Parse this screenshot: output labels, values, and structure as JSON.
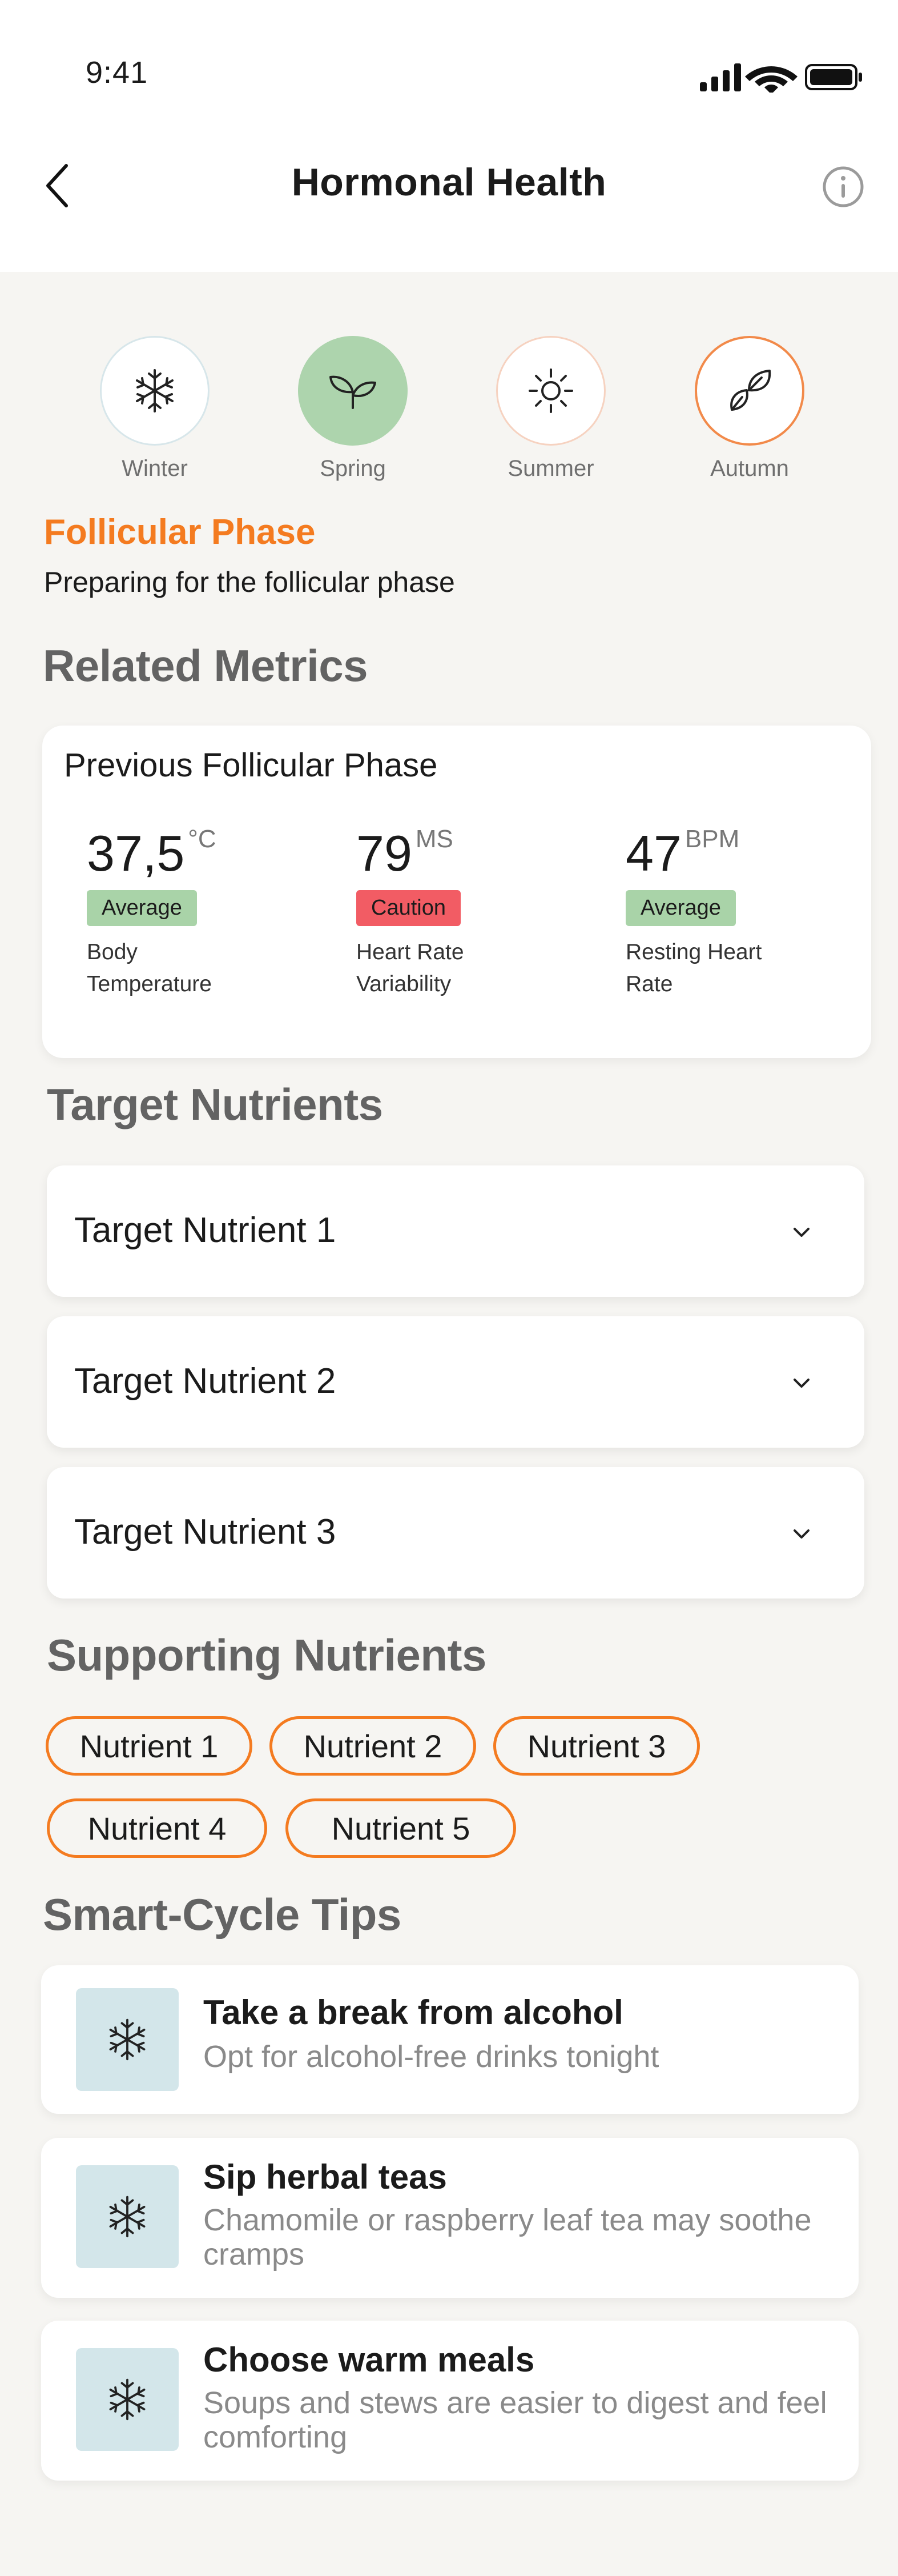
{
  "status_bar": {
    "time": "9:41"
  },
  "header": {
    "title": "Hormonal Health"
  },
  "seasons": [
    {
      "label": "Winter",
      "icon": "snowflake-icon",
      "selected": false
    },
    {
      "label": "Spring",
      "icon": "sprout-icon",
      "selected": true
    },
    {
      "label": "Summer",
      "icon": "sun-icon",
      "selected": false
    },
    {
      "label": "Autumn",
      "icon": "leaves-icon",
      "selected": false
    }
  ],
  "phase": {
    "title": "Follicular Phase",
    "subtitle": "Preparing for the follicular phase"
  },
  "related_metrics": {
    "heading": "Related Metrics",
    "card_title": "Previous Follicular Phase",
    "items": [
      {
        "value": "37,5",
        "unit": "°C",
        "status": "Average",
        "label": "Body Temperature"
      },
      {
        "value": "79",
        "unit": "MS",
        "status": "Caution",
        "label": "Heart Rate Variability"
      },
      {
        "value": "47",
        "unit": "BPM",
        "status": "Average",
        "label": "Resting Heart Rate"
      }
    ]
  },
  "target_nutrients": {
    "heading": "Target Nutrients",
    "items": [
      "Target Nutrient 1",
      "Target Nutrient 2",
      "Target Nutrient 3"
    ]
  },
  "supporting_nutrients": {
    "heading": "Supporting Nutrients",
    "items": [
      "Nutrient 1",
      "Nutrient 2",
      "Nutrient 3",
      "Nutrient 4",
      "Nutrient 5"
    ]
  },
  "smart_cycle_tips": {
    "heading": "Smart-Cycle Tips",
    "items": [
      {
        "title": "Take a break from alcohol",
        "description": "Opt for alcohol-free drinks tonight"
      },
      {
        "title": "Sip herbal teas",
        "description": "Chamomile or raspberry leaf tea may soothe cramps"
      },
      {
        "title": "Choose warm meals",
        "description": " Soups and stews are easier to digest and feel comforting"
      }
    ]
  },
  "colors": {
    "accent": "#f47b20",
    "spring_selected": "#add4ad",
    "average_badge": "#a9d3a8",
    "caution_badge": "#f25c64",
    "tip_icon_bg": "#d3e6ea"
  }
}
